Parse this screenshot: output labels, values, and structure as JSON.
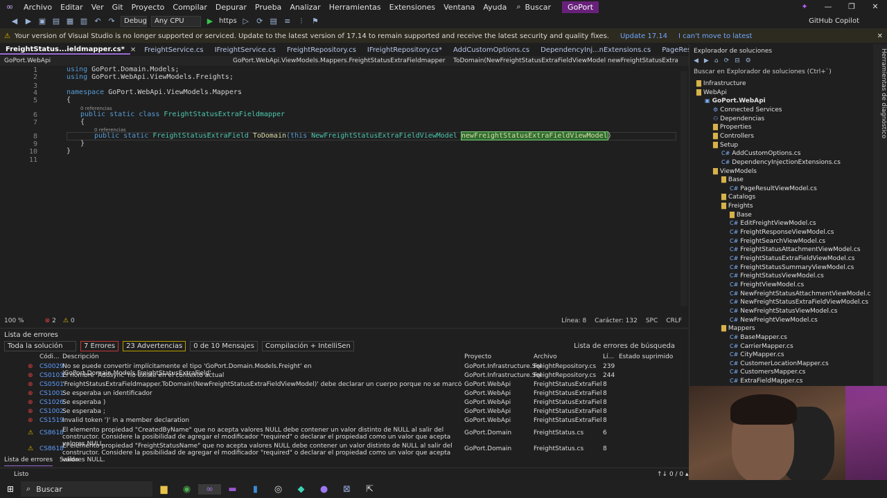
{
  "menubar": {
    "items": [
      "Archivo",
      "Editar",
      "Ver",
      "Git",
      "Proyecto",
      "Compilar",
      "Depurar",
      "Prueba",
      "Analizar",
      "Herramientas",
      "Extensiones",
      "Ventana",
      "Ayuda"
    ],
    "search_label": "Buscar",
    "project_badge": "GoPort"
  },
  "toolbar": {
    "config": "Debug",
    "platform": "Any CPU",
    "run_target": "https",
    "copilot_label": "GitHub Copilot"
  },
  "infobar": {
    "message": "Your version of Visual Studio is no longer supported or serviced. Update to the latest version of 17.14 to remain supported and receive the latest security and quality fixes.",
    "update_link": "Update 17.14",
    "cant_move_link": "I can't move to latest"
  },
  "doctabs": [
    "FreightStatus...ieldmapper.cs*",
    "FreightService.cs",
    "IFreightService.cs",
    "FreightRepository.cs",
    "IFreightRepository.cs*",
    "AddCustomOptions.cs",
    "DependencyInj...nExtensions.cs",
    "PageResultViewModel.cs"
  ],
  "navbar": {
    "project": "GoPort.WebApi",
    "type": "GoPort.WebApi.ViewModels.Mappers.FreightStatusExtraFieldmapper",
    "member": "ToDomain(NewFreightStatusExtraFieldViewModel newFreightStatusExtraFieldViewMo"
  },
  "editor": {
    "line_numbers": [
      "1",
      "2",
      "3",
      "4",
      "5",
      "6",
      "7",
      "8",
      "9",
      "10",
      "11"
    ],
    "refs_0": "0 referencias",
    "refs_1": "0 referencias",
    "l1_kw": "using",
    "l1_ns": "GoPort.Domain.Models;",
    "l2_kw": "using",
    "l2_ns": "GoPort.WebApi.ViewModels.Freights;",
    "l4_kw": "namespace",
    "l4_ns": "GoPort.WebApi.ViewModels.Mappers",
    "l5": "{",
    "l6_kw": "public static class",
    "l6_type": "FreightStatusExtraFieldmapper",
    "l7": "{",
    "l8_kw": "public static",
    "l8_type": "FreightStatusExtraField",
    "l8_method": "ToDomain",
    "l8_this": "(this",
    "l8_ptype": "NewFreightStatusExtraFieldViewModel",
    "l8_param": "newFreightStatusExtraFieldViewModel",
    "l8_close": ")",
    "l9": "}",
    "l10": "}"
  },
  "editor_status": {
    "zoom": "100 %",
    "errors": "2",
    "warnings": "0",
    "line": "Línea: 8",
    "char": "Carácter: 132",
    "spc": "SPC",
    "crlf": "CRLF"
  },
  "errorlist": {
    "title": "Lista de errores",
    "scope": "Toda la solución",
    "errors_btn": "7 Errores",
    "warnings_btn": "23 Advertencias",
    "messages_btn": "0 de 10 Mensajes",
    "build_filter": "Compilación + IntelliSen",
    "search_placeholder": "Lista de errores de búsqueda",
    "columns": {
      "code": "Códi...",
      "desc": "Descripción",
      "project": "Proyecto",
      "file": "Archivo",
      "line": "Lí...",
      "suppressed": "Estado suprimido"
    },
    "rows": [
      {
        "code": "CS0029",
        "desc": "No se puede convertir implícitamente el tipo 'GoPort.Domain.Models.Freight' en 'GoPort.Domain.Models.FreightStatusExtraField'",
        "project": "GoPort.Infrastructure.Sql",
        "file": "FreightRepository.cs",
        "line": "239"
      },
      {
        "code": "CS0103",
        "desc": "El nombre 'Addsync' no existe en el contexto actual",
        "project": "GoPort.Infrastructure.Sql",
        "file": "FreightRepository.cs",
        "line": "244"
      },
      {
        "code": "CS0501",
        "desc": "'FreightStatusExtraFieldmapper.ToDomain(NewFreightStatusExtraFieldViewModel)' debe declarar un cuerpo porque no se marcó como abstracto, externo o parcial",
        "project": "GoPort.WebApi",
        "file": "FreightStatusExtraFieldma...",
        "line": "8"
      },
      {
        "code": "CS1001",
        "desc": "Se esperaba un identificador",
        "project": "GoPort.WebApi",
        "file": "FreightStatusExtraFieldma...",
        "line": "8"
      },
      {
        "code": "CS1026",
        "desc": "Se esperaba )",
        "project": "GoPort.WebApi",
        "file": "FreightStatusExtraFieldma...",
        "line": "8"
      },
      {
        "code": "CS1002",
        "desc": "Se esperaba ;",
        "project": "GoPort.WebApi",
        "file": "FreightStatusExtraFieldma...",
        "line": "8"
      },
      {
        "code": "CS1519",
        "desc": "Invalid token ')' in a member declaration",
        "project": "GoPort.WebApi",
        "file": "FreightStatusExtraFieldma...",
        "line": "8"
      },
      {
        "code": "CS8618",
        "desc": "El elemento propiedad \"CreatedByName\" que no acepta valores NULL debe contener un valor distinto de NULL al salir del constructor. Considere la posibilidad de agregar el modificador \"required\" o declarar el propiedad como un valor que acepta valores NULL.",
        "project": "GoPort.Domain",
        "file": "FreightStatus.cs",
        "line": "6"
      },
      {
        "code": "CS8618",
        "desc": "El elemento propiedad \"FreightStatusName\" que no acepta valores NULL debe contener un valor distinto de NULL al salir del constructor. Considere la posibilidad de agregar el modificador \"required\" o declarar el propiedad como un valor que acepta valores NULL.",
        "project": "GoPort.Domain",
        "file": "FreightStatus.cs",
        "line": "8"
      }
    ]
  },
  "bottomtabs": [
    "Lista de errores",
    "Salida"
  ],
  "statusbar": {
    "state": "Listo",
    "git": "↑↓ 0 / 0 ▴"
  },
  "taskbar": {
    "search": "Buscar"
  },
  "solexp": {
    "title": "Explorador de soluciones",
    "search_placeholder": "Buscar en Explorador de soluciones (Ctrl+`)",
    "nodes": [
      {
        "label": "Infrastructure",
        "kind": "folder"
      },
      {
        "label": "WebApi",
        "kind": "folder"
      },
      {
        "label": "GoPort.WebApi",
        "kind": "project"
      },
      {
        "label": "Connected Services",
        "kind": "service"
      },
      {
        "label": "Dependencias",
        "kind": "deps"
      },
      {
        "label": "Properties",
        "kind": "folder"
      },
      {
        "label": "Controllers",
        "kind": "folder"
      },
      {
        "label": "Setup",
        "kind": "folder"
      },
      {
        "label": "AddCustomOptions.cs",
        "kind": "cs"
      },
      {
        "label": "DependencyInjectionExtensions.cs",
        "kind": "cs"
      },
      {
        "label": "ViewModels",
        "kind": "folder"
      },
      {
        "label": "Base",
        "kind": "folder"
      },
      {
        "label": "PageResultViewModel.cs",
        "kind": "cs"
      },
      {
        "label": "Catalogs",
        "kind": "folder"
      },
      {
        "label": "Freights",
        "kind": "folder"
      },
      {
        "label": "Base",
        "kind": "folder"
      },
      {
        "label": "EditFreightViewModel.cs",
        "kind": "cs"
      },
      {
        "label": "FreightResponseViewModel.cs",
        "kind": "cs"
      },
      {
        "label": "FreightSearchViewModel.cs",
        "kind": "cs"
      },
      {
        "label": "FreightStatusAttachmentViewModel.cs",
        "kind": "cs"
      },
      {
        "label": "FreightStatusExtraFieldViewModel.cs",
        "kind": "cs"
      },
      {
        "label": "FreightStatusSummaryViewModel.cs",
        "kind": "cs"
      },
      {
        "label": "FreightStatusViewModel.cs",
        "kind": "cs"
      },
      {
        "label": "FreightViewModel.cs",
        "kind": "cs"
      },
      {
        "label": "NewFreightStatusAttachmentViewModel.cs",
        "kind": "cs"
      },
      {
        "label": "NewFreightStatusExtraFieldViewModel.cs",
        "kind": "cs"
      },
      {
        "label": "NewFreightStatusViewModel.cs",
        "kind": "cs"
      },
      {
        "label": "NewFreightViewModel.cs",
        "kind": "cs"
      },
      {
        "label": "Mappers",
        "kind": "folder"
      },
      {
        "label": "BaseMapper.cs",
        "kind": "cs"
      },
      {
        "label": "CarrierMapper.cs",
        "kind": "cs"
      },
      {
        "label": "CityMapper.cs",
        "kind": "cs"
      },
      {
        "label": "CustomerLocationMapper.cs",
        "kind": "cs"
      },
      {
        "label": "CustomersMapper.cs",
        "kind": "cs"
      },
      {
        "label": "ExtraFieldMapper.cs",
        "kind": "cs"
      }
    ]
  },
  "side_panel": "Herramientas de diagnóstico"
}
